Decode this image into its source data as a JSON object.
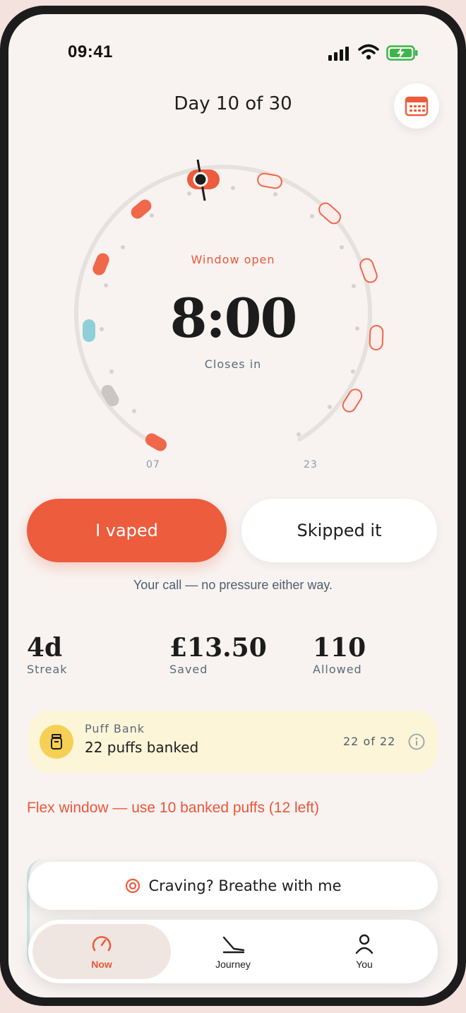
{
  "status_bar": {
    "time": "09:41"
  },
  "header": {
    "title": "Day 10 of 30"
  },
  "dial": {
    "window_label": "Window open",
    "timer": "8:00",
    "timer_caption": "Closes in",
    "start_label": "07",
    "end_label": "23"
  },
  "actions": {
    "vaped_label": "I vaped",
    "skipped_label": "Skipped it",
    "note": "Your call — no pressure either way."
  },
  "stats": [
    {
      "value": "4d",
      "label": "Streak"
    },
    {
      "value": "£13.50",
      "label": "Saved"
    },
    {
      "value": "110",
      "label": "Allowed"
    }
  ],
  "puff_bank": {
    "title": "Puff Bank",
    "value": "22 puffs banked",
    "count": "22 of 22"
  },
  "flex_window": "Flex window — use 10 banked puffs (12 left)",
  "craving_button": "Craving? Breathe with me",
  "tabs": [
    {
      "label": "Now",
      "icon": "gauge-icon",
      "active": true
    },
    {
      "label": "Journey",
      "icon": "journey-icon",
      "active": false
    },
    {
      "label": "You",
      "icon": "person-icon",
      "active": false
    }
  ],
  "colors": {
    "accent": "#ec5c3d",
    "used": "#f0674a",
    "skipped": "#8fcfd8",
    "missed": "#c9c6c3",
    "bank": "#fdf5d8"
  }
}
